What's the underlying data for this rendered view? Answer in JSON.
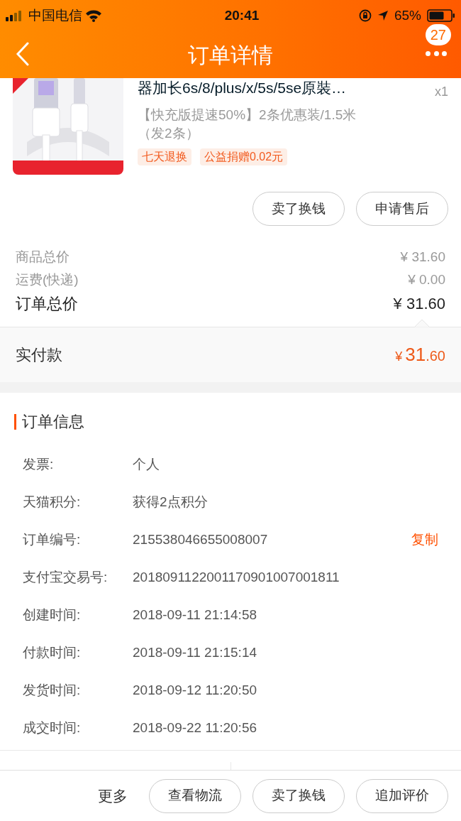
{
  "status_bar": {
    "carrier": "中国电信",
    "time": "20:41",
    "battery_text": "65%"
  },
  "header": {
    "title": "订单详情",
    "badge": "27"
  },
  "product": {
    "title": "器加长6s/8/plus/x/5s/5se原裝…",
    "quantity": "x1",
    "sku": "【快充版提速50%】2条优惠装/1.5米（发2条）",
    "tags": [
      "七天退换",
      "公益捐赠0.02元"
    ],
    "actions": [
      "卖了换钱",
      "申请售后"
    ]
  },
  "prices": [
    {
      "label": "商品总价",
      "value": "¥ 31.60",
      "kind": "minor"
    },
    {
      "label": "运费(快递)",
      "value": "¥ 0.00",
      "kind": "minor"
    },
    {
      "label": "订单总价",
      "value": "¥ 31.60",
      "kind": "major"
    }
  ],
  "paid": {
    "label": "实付款",
    "currency": "¥",
    "integer": "31",
    "decimal": ".60"
  },
  "order_info": {
    "title": "订单信息",
    "rows": [
      {
        "label": "发票:",
        "value": "个人"
      },
      {
        "label": "天猫积分:",
        "value": "获得2点积分"
      },
      {
        "label": "订单编号:",
        "value": "215538046655008007",
        "action": "复制"
      },
      {
        "label": "支付宝交易号:",
        "value": "2018091122001170901007001811"
      },
      {
        "label": "创建时间:",
        "value": "2018-09-11 21:14:58"
      },
      {
        "label": "付款时间:",
        "value": "2018-09-11 21:15:14"
      },
      {
        "label": "发货时间:",
        "value": "2018-09-12 11:20:50"
      },
      {
        "label": "成交时间:",
        "value": "2018-09-22 11:20:56"
      }
    ]
  },
  "bottom_bar": {
    "more": "更多",
    "buttons": [
      "查看物流",
      "卖了换钱",
      "追加评价"
    ]
  }
}
